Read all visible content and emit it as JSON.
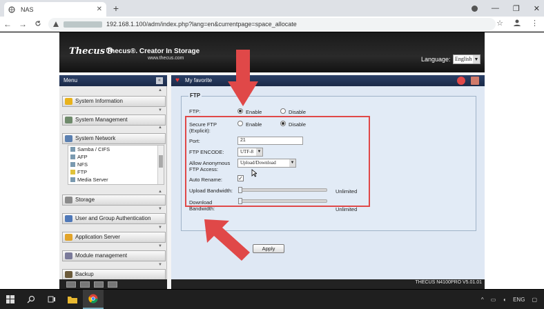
{
  "browser": {
    "tab_title": "NAS",
    "tab_close": "✕",
    "new_tab": "+",
    "url": "192.168.1.100/adm/index.php?lang=en&currentpage=space_allocate",
    "win_min": "—",
    "win_restore": "❐",
    "win_close": "✕",
    "back": "←",
    "forward": "→",
    "reload": "C",
    "star": "☆",
    "more": "⋮"
  },
  "header": {
    "logo": "Thecus®",
    "tagline": "Thecus®. Creator In Storage",
    "website": "www.thecus.com",
    "language_label": "Language:",
    "language_value": "English"
  },
  "menu": {
    "title": "Menu",
    "collapse": "«",
    "items": [
      {
        "label": "System Information"
      },
      {
        "label": "System Management"
      },
      {
        "label": "System Network"
      },
      {
        "label": "Storage"
      },
      {
        "label": "User and Group Authentication"
      },
      {
        "label": "Application Server"
      },
      {
        "label": "Module management"
      },
      {
        "label": "Backup"
      }
    ],
    "subitems": [
      {
        "label": "Samba / CIFS"
      },
      {
        "label": "AFP"
      },
      {
        "label": "NFS"
      },
      {
        "label": "FTP"
      },
      {
        "label": "Media Server"
      }
    ]
  },
  "favorites": {
    "title": "My favorite"
  },
  "ftp": {
    "legend": "FTP",
    "ftp_label": "FTP:",
    "enable": "Enable",
    "disable": "Disable",
    "secure_label": "Secure FTP (Explicit):",
    "port_label": "Port:",
    "port_value": "21",
    "encode_label": "FTP ENCODE:",
    "encode_value": "UTF-8",
    "anon_label": "Allow Anonymous FTP Access:",
    "anon_value": "Upload/Download",
    "rename_label": "Auto Rename:",
    "upload_label": "Upload Bandwidth:",
    "upload_value": "Unlimited",
    "download_label": "Download Bandwidth:",
    "download_value": "Unlimited",
    "apply": "Apply",
    "ftp_enabled": true,
    "secure_enabled": false,
    "auto_rename": true
  },
  "footer": {
    "version": "THECUS N4100PRO V5.01.01"
  },
  "taskbar": {
    "lang": "ENG"
  },
  "colors": {
    "annotation": "#e04848",
    "menu_header": "#2b3f66"
  }
}
